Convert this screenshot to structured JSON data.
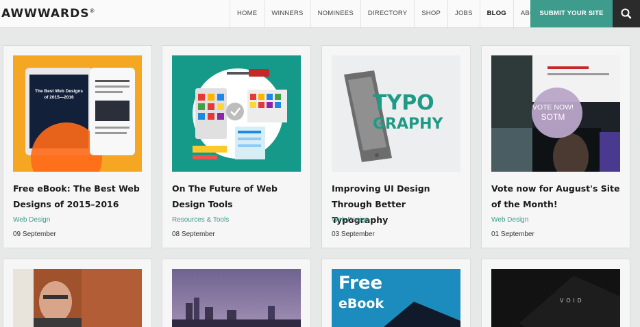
{
  "header": {
    "logo": "AWWWARDS",
    "logo_mark": "®",
    "nav": [
      "HOME",
      "WINNERS",
      "NOMINEES",
      "DIRECTORY",
      "SHOP",
      "JOBS",
      "BLOG",
      "ABOUT US"
    ],
    "active_nav": "BLOG",
    "submit_label": "SUBMIT YOUR SITE",
    "search_icon": "search-icon"
  },
  "colors": {
    "accent": "#3e9c8c",
    "dark": "#2b2b2b",
    "ebook_bg": "#f5a623",
    "tools_bg": "#159a8a",
    "free_bg": "#1c8bbd"
  },
  "posts": [
    {
      "title": "Free eBook: The Best Web Designs of 2015–2016",
      "category": "Web Design",
      "date": "09 September",
      "thumb_book_title": "The Best Web Designs of 2015—2016"
    },
    {
      "title": "On The Future of Web Design Tools",
      "category": "Resources & Tools",
      "date": "08 September"
    },
    {
      "title": "Improving UI Design Through Better Typography",
      "category": "Web Design",
      "date": "03 September",
      "thumb_word_1": "TYPO",
      "thumb_word_2": "GRAPHY"
    },
    {
      "title": "Vote now for August's Site of the Month!",
      "category": "Web Design",
      "date": "01 September",
      "thumb_vote": "VOTE NOW!",
      "thumb_sotm": "SOTM"
    }
  ],
  "posts_row2": [
    {
      "thumb": "portrait"
    },
    {
      "thumb": "city-night"
    },
    {
      "thumb": "ebook",
      "thumb_free": "Free",
      "thumb_ebook": "eBook"
    },
    {
      "thumb": "void",
      "thumb_text": "VOID"
    }
  ]
}
